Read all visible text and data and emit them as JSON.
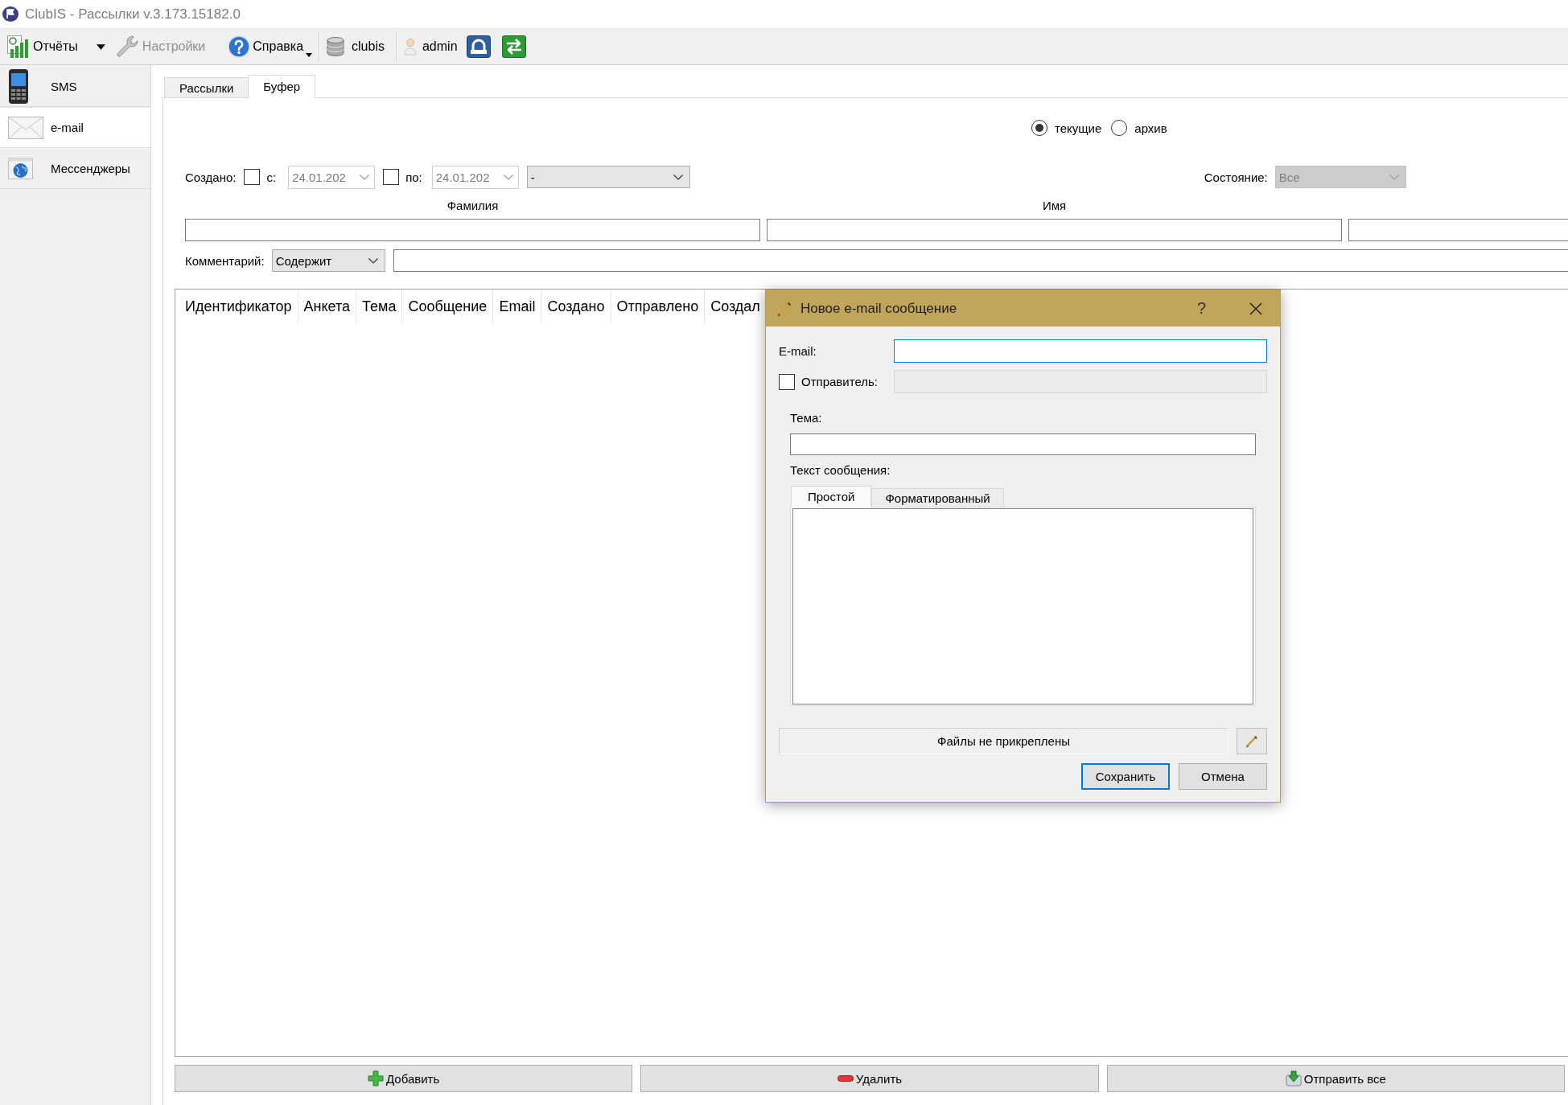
{
  "window": {
    "title": "ClubIS - Рассылки v.3.173.15182.0"
  },
  "toolbar": {
    "reports": {
      "label": "Отчёты",
      "disabled": false
    },
    "settings": {
      "label": "Настройки",
      "disabled": true
    },
    "help": {
      "label": "Справка",
      "disabled": false
    },
    "database": {
      "label": "clubis",
      "disabled": false
    },
    "user": {
      "label": "admin",
      "disabled": false
    }
  },
  "sidebar": {
    "items": [
      {
        "label": "SMS",
        "selected": false
      },
      {
        "label": "e-mail",
        "selected": true
      },
      {
        "label": "Мессенджеры",
        "selected": false
      }
    ]
  },
  "tabs": [
    {
      "label": "Рассылки",
      "selected": false
    },
    {
      "label": "Буфер",
      "selected": true
    }
  ],
  "filters": {
    "scope": [
      {
        "label": "текущие",
        "selected": true
      },
      {
        "label": "архив",
        "selected": false
      }
    ],
    "created": {
      "label": "Создано:",
      "from": {
        "label": "с:",
        "checked": false,
        "value": "24.01.202",
        "disabled": true
      },
      "to": {
        "label": "по:",
        "checked": false,
        "value": "24.01.202",
        "disabled": true
      },
      "period": {
        "value": "-",
        "disabled": false
      }
    },
    "status": {
      "label": "Состояние:",
      "value": "Все",
      "disabled": true
    },
    "name_fields": [
      {
        "label": "Фамилия"
      },
      {
        "label": "Имя"
      }
    ],
    "comment": {
      "label": "Комментарий:",
      "mode": "Содержит"
    }
  },
  "table": {
    "columns": [
      "Идентификатор",
      "Анкета",
      "Тема",
      "Сообщение",
      "Email",
      "Создано",
      "Отправлено",
      "Создал"
    ]
  },
  "actions": [
    {
      "label": "Добавить"
    },
    {
      "label": "Удалить"
    },
    {
      "label": "Отправить все"
    }
  ],
  "dialog": {
    "title": "Новое e-mail сообщение",
    "help": "?",
    "email": {
      "label": "E-mail:",
      "focused": true
    },
    "sender": {
      "label": "Отправитель:",
      "checked": false,
      "disabled": true
    },
    "subject": {
      "label": "Тема:"
    },
    "body": {
      "label": "Текст сообщения:",
      "tabs": [
        {
          "label": "Простой",
          "selected": true
        },
        {
          "label": "Форматированный",
          "selected": false
        }
      ]
    },
    "attachments": {
      "text": "Файлы не прикреплены"
    },
    "buttons": [
      {
        "label": "Сохранить",
        "default": true
      },
      {
        "label": "Отмена",
        "default": false
      }
    ]
  }
}
